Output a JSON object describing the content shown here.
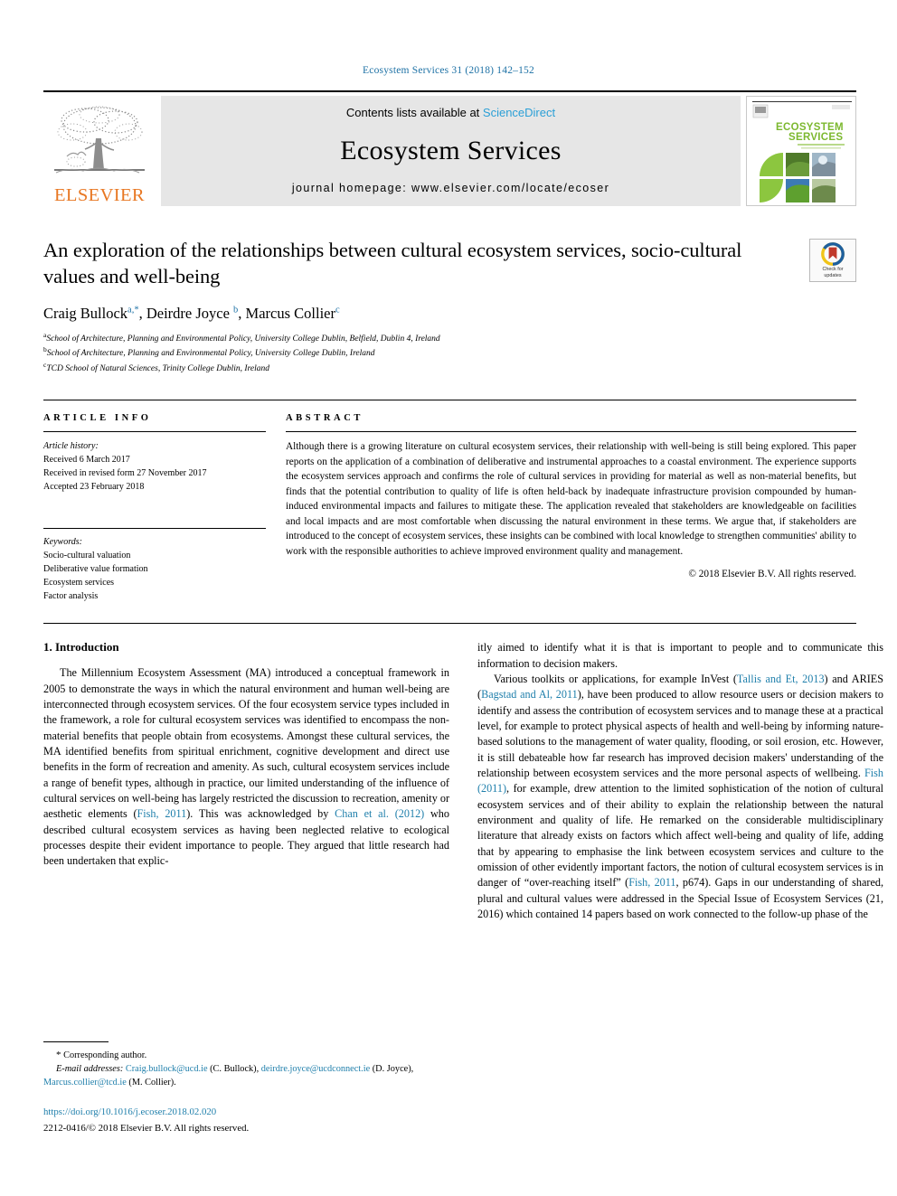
{
  "running_head": "Ecosystem Services 31 (2018) 142–152",
  "masthead": {
    "contents_prefix": "Contents lists available at ",
    "sciencedirect": "ScienceDirect",
    "journal_name": "Ecosystem Services",
    "homepage": "journal homepage: www.elsevier.com/locate/ecoser",
    "publisher_wordmark": "ELSEVIER",
    "cover_title_line1": "ECOSYSTEM",
    "cover_title_line2": "SERVICES",
    "colors": {
      "link_blue": "#2a9fd6",
      "elsevier_orange": "#e87722",
      "band_gray": "#e6e6e6",
      "cover_green": "#8cc63f"
    }
  },
  "article": {
    "title": "An exploration of the relationships between cultural ecosystem services, socio-cultural values and well-being",
    "authors_html": "Craig Bullock<sup>a,*</sup>, Deirdre Joyce <sup>b</sup>, Marcus Collier<sup>c</sup>",
    "affiliations": [
      {
        "marker": "a",
        "text": "School of Architecture, Planning and Environmental Policy, University College Dublin, Belfield, Dublin 4, Ireland"
      },
      {
        "marker": "b",
        "text": "School of Architecture, Planning and Environmental Policy, University College Dublin, Ireland"
      },
      {
        "marker": "c",
        "text": "TCD School of Natural Sciences, Trinity College Dublin, Ireland"
      }
    ],
    "crossmark_line1": "Check for",
    "crossmark_line2": "updates"
  },
  "article_info": {
    "heading": "ARTICLE INFO",
    "history_title": "Article history:",
    "history": [
      "Received 6 March 2017",
      "Received in revised form 27 November 2017",
      "Accepted 23 February 2018"
    ],
    "keywords_title": "Keywords:",
    "keywords": [
      "Socio-cultural valuation",
      "Deliberative value formation",
      "Ecosystem services",
      "Factor analysis"
    ]
  },
  "abstract": {
    "heading": "ABSTRACT",
    "text": "Although there is a growing literature on cultural ecosystem services, their relationship with well-being is still being explored. This paper reports on the application of a combination of deliberative and instrumental approaches to a coastal environment. The experience supports the ecosystem services approach and confirms the role of cultural services in providing for material as well as non-material benefits, but finds that the potential contribution to quality of life is often held-back by inadequate infrastructure provision compounded by human-induced environmental impacts and failures to mitigate these. The application revealed that stakeholders are knowledgeable on facilities and local impacts and are most comfortable when discussing the natural environment in these terms. We argue that, if stakeholders are introduced to the concept of ecosystem services, these insights can be combined with local knowledge to strengthen communities' ability to work with the responsible authorities to achieve improved environment quality and management.",
    "copyright": "© 2018 Elsevier B.V. All rights reserved."
  },
  "body": {
    "section_heading": "1. Introduction",
    "left_paragraph_1": "The Millennium Ecosystem Assessment (MA) introduced a conceptual framework in 2005 to demonstrate the ways in which the natural environment and human well-being are interconnected through ecosystem services. Of the four ecosystem service types included in the framework, a role for cultural ecosystem services was identified to encompass the non-material benefits that people obtain from ecosystems. Amongst these cultural services, the MA identified benefits from spiritual enrichment, cognitive development and direct use benefits in the form of recreation and amenity. As such, cultural ecosystem services include a range of benefit types, although in practice, our limited understanding of the influence of cultural services on well-being has largely restricted the discussion to recreation, amenity or aesthetic elements (",
    "cite_fish_2011_a": "Fish, 2011",
    "left_paragraph_1b": "). This was acknowledged by ",
    "cite_chan_2012": "Chan et al. (2012)",
    "left_paragraph_1c": " who described cultural ecosystem services as having been neglected relative to ecological processes despite their evident importance to people. They argued that little research had been undertaken that explic-",
    "right_paragraph_1": "itly aimed to identify what it is that is important to people and to communicate this information to decision makers.",
    "right_paragraph_2a": "Various toolkits or applications, for example InVest (",
    "cite_tallis_2013": "Tallis and Et, 2013",
    "right_paragraph_2b": ") and ARIES (",
    "cite_bagstad_2011": "Bagstad and Al, 2011",
    "right_paragraph_2c": "), have been produced to allow resource users or decision makers to identify and assess the contribution of ecosystem services and to manage these at a practical level, for example to protect physical aspects of health and well-being by informing nature-based solutions to the management of water quality, flooding, or soil erosion, etc. However, it is still debateable how far research has improved decision makers' understanding of the relationship between ecosystem services and the more personal aspects of wellbeing. ",
    "cite_fish_2011_b": "Fish (2011)",
    "right_paragraph_2d": ", for example, drew attention to the limited sophistication of the notion of cultural ecosystem services and of their ability to explain the relationship between the natural environment and quality of life. He remarked on the considerable multidisciplinary literature that already exists on factors which affect well-being and quality of life, adding that by appearing to emphasise the link between ecosystem services and culture to the omission of other evidently important factors, the notion of cultural ecosystem services is in danger of “over-reaching itself” (",
    "cite_fish_2011_c": "Fish, 2011",
    "right_paragraph_2e": ", p674). Gaps in our understanding of shared, plural and cultural values were addressed in the Special Issue of Ecosystem Services (21, 2016) which contained 14 papers based on work connected to the follow-up phase of the"
  },
  "footnotes": {
    "corresponding_star": "*",
    "corresponding_text": "Corresponding author.",
    "email_label": "E-mail addresses:",
    "email_1": "Craig.bullock@ucd.ie",
    "email_1_owner": "(C. Bullock),",
    "email_2": "deirdre.joyce@ucdconnect.ie",
    "email_2_owner": "(D. Joyce),",
    "email_3": "Marcus.collier@tcd.ie",
    "email_3_owner": "(M. Collier).",
    "doi": "https://doi.org/10.1016/j.ecoser.2018.02.020",
    "issn_line": "2212-0416/© 2018 Elsevier B.V. All rights reserved."
  }
}
